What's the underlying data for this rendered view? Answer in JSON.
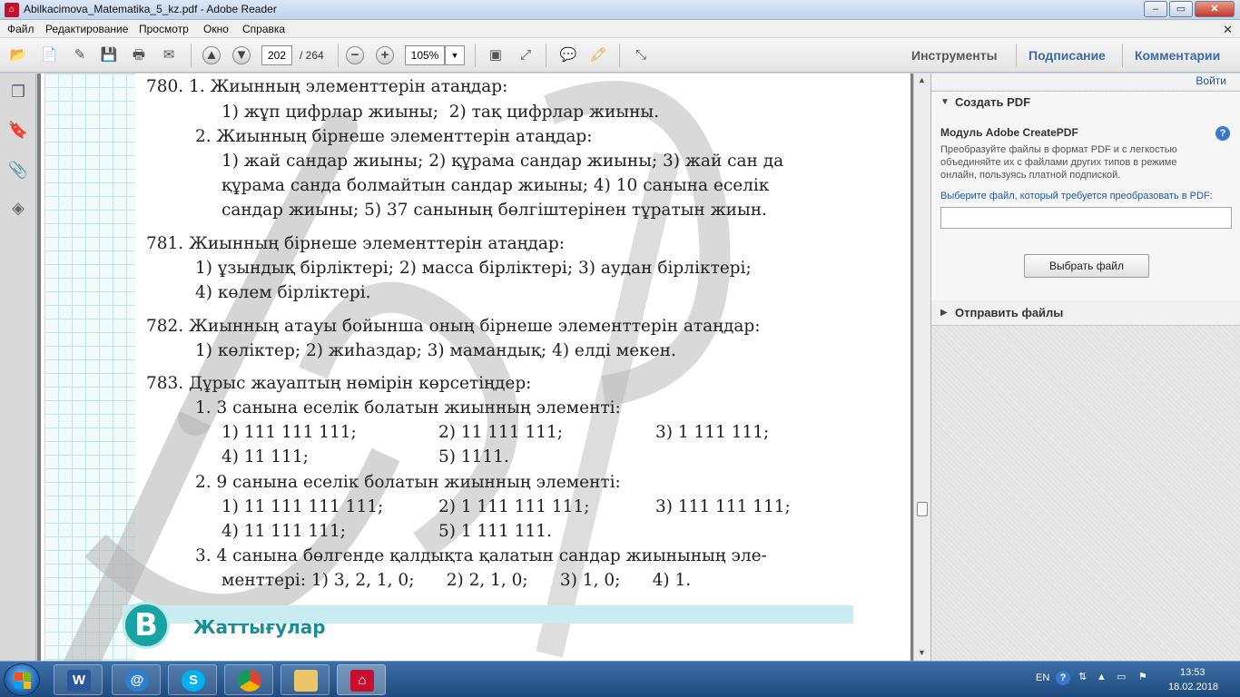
{
  "window": {
    "title": "Abilkacimova_Matematika_5_kz.pdf - Adobe Reader",
    "controls": {
      "minimize": "–",
      "maximize": "▭",
      "close": "✕"
    }
  },
  "menu": {
    "items": [
      "Файл",
      "Редактирование",
      "Просмотр",
      "Окно",
      "Справка"
    ],
    "close_glyph": "✕"
  },
  "toolbar": {
    "page_current": "202",
    "page_total": "/ 264",
    "zoom": "105%",
    "links": {
      "tools": "Инструменты",
      "sign": "Подписание",
      "comments": "Комментарии"
    },
    "colors": {
      "links": "#5a5a5a",
      "link_accent": "#3d6aa8"
    }
  },
  "document": {
    "lines": [
      "780. 1. Жиынның элементтерін атаңдар:",
      "1) жұп цифрлар жиыны;  2) тақ цифрлар жиыны.",
      "2. Жиынның бірнеше элементтерін атаңдар:",
      "1) жай сандар жиыны; 2) құрама сандар жиыны; 3) жай сан да",
      "құрама санда болмайтын сандар жиыны; 4) 10 санына еселік",
      "сандар жиыны; 5) 37 санының бөлгіштерінен тұратын жиын.",
      "781. Жиынның бірнеше элементтерін атаңдар:",
      "1) ұзындық бірліктері; 2) масса бірліктері; 3) аудан бірліктері;",
      "4) көлем бірліктері.",
      "782. Жиынның атауы бойынша оның бірнеше элементтерін атаңдар:",
      "1) көліктер; 2) жиһаздар; 3) мамандық; 4) елді мекен.",
      "783. Дұрыс жауаптың нөмірін көрсетіңдер:",
      "1. 3 санына еселік болатын жиынның элементі:",
      "1) 111 111 111;",
      "2) 11 111 111;",
      "3) 1 111 111;",
      "4) 11 111;",
      "5) 1111.",
      "2. 9 санына еселік болатын жиынның элементі:",
      "1) 11 111 111 111;",
      "2) 1 111 111 111;",
      "3) 111 111 111;",
      "4) 11 111 111;",
      "5) 1 111 111.",
      "3. 4 санына бөлгенде қалдықта қалатын сандар жиынының эле-",
      "менттері: 1) 3, 2, 1, 0;      2) 2, 1, 0;      3) 1, 0;      4) 1."
    ],
    "section_badge": "B",
    "section_title": "Жаттығулар",
    "colors": {
      "section": "#1a8e94",
      "grid": "#bfe6ec",
      "watermark": "#b3b3b3"
    }
  },
  "right_pane": {
    "signin": "Войти",
    "create_pdf_header": "Создать PDF",
    "module_title": "Модуль Adobe CreatePDF",
    "description": "Преобразуйте файлы в формат PDF и с легкостью объединяйте их с файлами других типов в режиме онлайн, пользуясь платной подпиской.",
    "prompt": "Выберите файл, который требуется преобразовать в PDF:",
    "choose_button": "Выбрать файл",
    "send_files": "Отправить файлы",
    "help_glyph": "?"
  },
  "taskbar": {
    "language": "EN",
    "time": "13:53",
    "date": "18.02.2018",
    "apps": [
      "word-icon",
      "mail-icon",
      "skype-icon",
      "chrome-icon",
      "folder-icon",
      "adobe-reader-icon"
    ],
    "colors": {
      "word": "#2b579a",
      "mail": "#2f7fd1",
      "skype": "#00aff0",
      "chrome": "#db4437",
      "folder": "#e9c66a",
      "reader": "#c8102e"
    }
  }
}
